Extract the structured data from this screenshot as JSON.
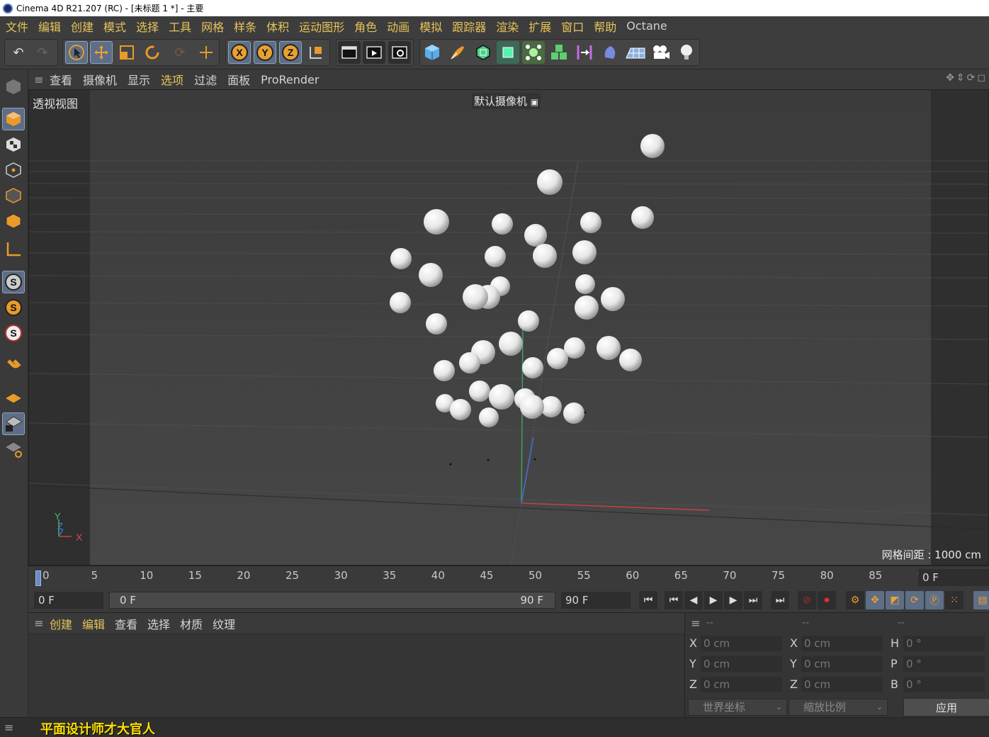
{
  "window": {
    "title": "Cinema 4D R21.207 (RC) - [未标题 1 *] - 主要"
  },
  "menubar": {
    "items": [
      "文件",
      "编辑",
      "创建",
      "模式",
      "选择",
      "工具",
      "网格",
      "样条",
      "体积",
      "运动图形",
      "角色",
      "动画",
      "模拟",
      "跟踪器",
      "渲染",
      "扩展",
      "窗口",
      "帮助",
      "Octane"
    ]
  },
  "toolbar": {
    "tools": [
      "undo-icon",
      "redo-icon",
      "select-cursor-icon",
      "move-icon",
      "scale-icon",
      "rotate-icon",
      "recent-tool-icon",
      "last-tool-icon",
      "x-axis-icon",
      "y-axis-icon",
      "z-axis-icon",
      "coordinate-system-icon",
      "render-view-icon",
      "render-picture-viewer-icon",
      "render-settings-icon",
      "cube-icon",
      "pen-icon",
      "subdivision-icon",
      "extrude-icon",
      "cloner-icon",
      "array-icon",
      "symmetry-icon",
      "deformer-icon",
      "floor-icon",
      "camera-icon",
      "light-icon"
    ],
    "axis_labels": [
      "X",
      "Y",
      "Z"
    ]
  },
  "viewport": {
    "menu": [
      "查看",
      "摄像机",
      "显示",
      "选项",
      "过滤",
      "面板",
      "ProRender"
    ],
    "highlight_menu": "选项",
    "view_name": "透视视图",
    "camera_name": "默认摄像机",
    "grid_spacing": "网格间距 : 1000 cm",
    "axis_x": "X",
    "axis_y": "Y",
    "axis_z": "Z"
  },
  "timeline": {
    "ticks": [
      "0",
      "5",
      "10",
      "15",
      "20",
      "25",
      "30",
      "35",
      "40",
      "45",
      "50",
      "55",
      "60",
      "65",
      "70",
      "75",
      "80",
      "85",
      "90"
    ],
    "current_frame": "0 F",
    "start_frame": "0 F",
    "slider_start": "0 F",
    "slider_end": "90 F",
    "end_frame": "90 F"
  },
  "material_manager": {
    "menu": [
      "创建",
      "编辑",
      "查看",
      "选择",
      "材质",
      "纹理"
    ]
  },
  "coordinates": {
    "headers": [
      "--",
      "--",
      "--"
    ],
    "position": [
      {
        "axis": "X",
        "value": "0 cm"
      },
      {
        "axis": "Y",
        "value": "0 cm"
      },
      {
        "axis": "Z",
        "value": "0 cm"
      }
    ],
    "size": [
      {
        "axis": "X",
        "value": "0 cm"
      },
      {
        "axis": "Y",
        "value": "0 cm"
      },
      {
        "axis": "Z",
        "value": "0 cm"
      }
    ],
    "rotation": [
      {
        "axis": "H",
        "value": "0 °"
      },
      {
        "axis": "P",
        "value": "0 °"
      },
      {
        "axis": "B",
        "value": "0 °"
      }
    ],
    "coord_mode": "世界坐标",
    "scale_mode": "缩放比例",
    "apply_label": "应用"
  },
  "statusbar": {
    "watermark": "平面设计师才大官人"
  },
  "colors": {
    "accent_menu": "#e8c45a",
    "x_axis": "#d04040",
    "y_axis": "#40b060",
    "z_axis": "#4070d0"
  }
}
